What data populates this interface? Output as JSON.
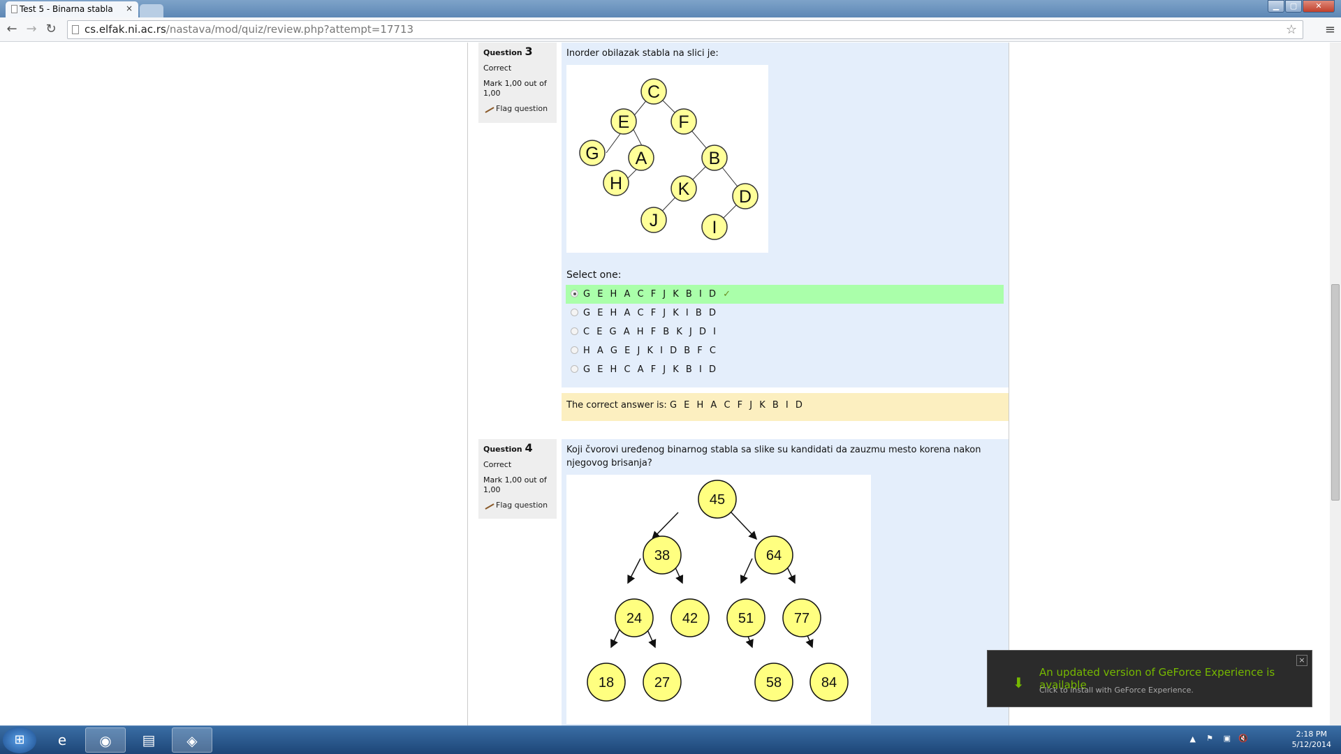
{
  "browser": {
    "tab_title": "Test 5 - Binarna stabla",
    "tab_close": "×",
    "url_host": "cs.elfak.ni.ac.rs",
    "url_path": "/nastava/mod/quiz/review.php?attempt=17713"
  },
  "questions": [
    {
      "label": "Question",
      "number": "3",
      "state": "Correct",
      "mark": "Mark 1,00 out of 1,00",
      "flag": "Flag question",
      "text": "Inorder obilazak stabla na slici je:",
      "tree_nodes": [
        "C",
        "E",
        "F",
        "G",
        "A",
        "B",
        "H",
        "K",
        "D",
        "J",
        "I"
      ],
      "prompt": "Select one:",
      "options": [
        "G E H A C F J K B I D",
        "G E H A C F J K I B D",
        "C E G A H F B K J D I",
        "H A G E J K I D B F C",
        "G E H C A F J K B I D"
      ],
      "selected_index": 0,
      "correct_mark": "✓",
      "answer_prefix": "The correct answer is: ",
      "answer": "G E H A C F J K B I D"
    },
    {
      "label": "Question",
      "number": "4",
      "state": "Correct",
      "mark": "Mark 1,00 out of 1,00",
      "flag": "Flag question",
      "text": "Koji čvorovi uređenog binarnog stabla sa slike su kandidati da zauzmu mesto korena nakon njegovog brisanja?",
      "tree_nodes": [
        "45",
        "38",
        "64",
        "24",
        "42",
        "51",
        "77",
        "18",
        "27",
        "58",
        "84"
      ]
    }
  ],
  "notification": {
    "title": "An updated version of GeForce Experience is available",
    "subtitle": "Click to install with GeForce Experience.",
    "close": "×"
  },
  "clock": {
    "time": "2:18 PM",
    "date": "5/12/2014"
  }
}
